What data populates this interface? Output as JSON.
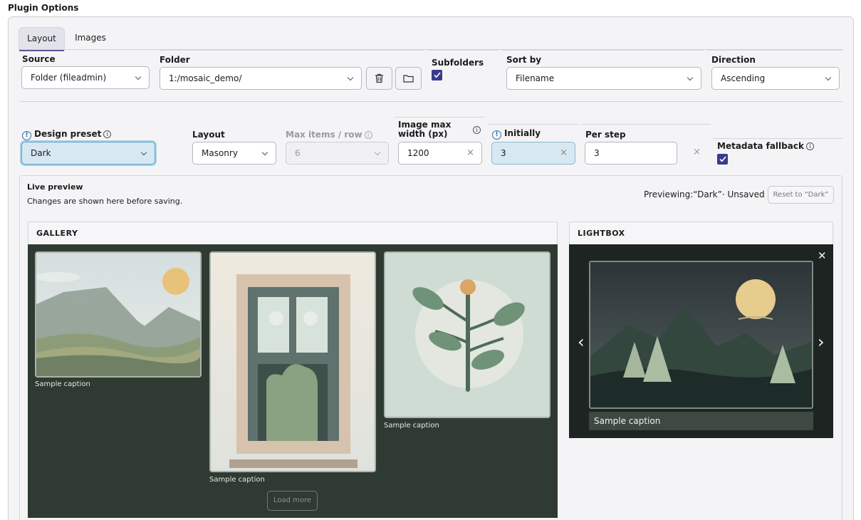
{
  "page_title": "Plugin Options",
  "tabs": [
    {
      "label": "Layout",
      "active": true
    },
    {
      "label": "Images",
      "active": false
    }
  ],
  "source": {
    "label": "Source",
    "value": "Folder (fileadmin)"
  },
  "folder": {
    "label": "Folder",
    "value": "1:/mosaic_demo/"
  },
  "subfolders": {
    "label": "Subfolders",
    "checked": true
  },
  "sort_by": {
    "label": "Sort by",
    "value": "Filename"
  },
  "direction": {
    "label": "Direction",
    "value": "Ascending"
  },
  "design_preset": {
    "label": "Design preset",
    "value": "Dark"
  },
  "layout": {
    "label": "Layout",
    "value": "Masonry"
  },
  "max_items": {
    "label": "Max items / row",
    "value": "6"
  },
  "image_max_width": {
    "label_line1": "Image max",
    "label_line2": "width (px)",
    "value": "1200"
  },
  "initially": {
    "label": "Initially",
    "value": "3"
  },
  "per_step": {
    "label": "Per step",
    "value": "3"
  },
  "metadata_fallback": {
    "label": "Metadata fallback",
    "checked": true
  },
  "live_preview": {
    "title": "Live preview",
    "subtitle": "Changes are shown here before saving.",
    "status": "Previewing:“Dark”· Unsaved",
    "reset_label": "Reset to “Dark”"
  },
  "gallery": {
    "header": "GALLERY",
    "captions": [
      "Sample caption",
      "Sample caption",
      "Sample caption"
    ],
    "load_more": "Load more"
  },
  "lightbox": {
    "header": "LIGHTBOX",
    "caption": "Sample caption"
  },
  "glyphs": {
    "close": "✕",
    "prev": "‹",
    "next": "›",
    "info": "i",
    "warn": "!",
    "clear": "×"
  },
  "colors": {
    "accent": "#3a3a8c",
    "gallery_bg": "#2f3a33",
    "lightbox_bg": "#1e2421",
    "focus": "#5fa3ca"
  }
}
